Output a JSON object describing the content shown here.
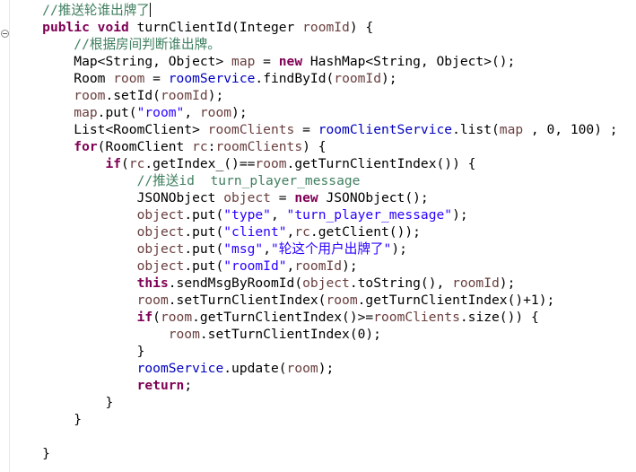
{
  "editor": {
    "lines": [
      {
        "indent": 4,
        "tokens": [
          {
            "c": "cm",
            "t": "//推送轮谁出牌了"
          }
        ],
        "caret": true
      },
      {
        "indent": 4,
        "tokens": [
          {
            "c": "kw",
            "t": "public"
          },
          {
            "c": "",
            "t": " "
          },
          {
            "c": "kw",
            "t": "void"
          },
          {
            "c": "",
            "t": " turnClientId(Integer "
          },
          {
            "c": "vr",
            "t": "roomId"
          },
          {
            "c": "",
            "t": ") {"
          }
        ]
      },
      {
        "indent": 8,
        "tokens": [
          {
            "c": "cm",
            "t": "//根据房间判断谁出牌。"
          }
        ]
      },
      {
        "indent": 8,
        "tokens": [
          {
            "c": "",
            "t": "Map<String, Object> "
          },
          {
            "c": "vr",
            "t": "map"
          },
          {
            "c": "",
            "t": " = "
          },
          {
            "c": "kw",
            "t": "new"
          },
          {
            "c": "",
            "t": " HashMap<String, Object>();"
          }
        ]
      },
      {
        "indent": 8,
        "tokens": [
          {
            "c": "",
            "t": "Room "
          },
          {
            "c": "vr",
            "t": "room"
          },
          {
            "c": "",
            "t": " = "
          },
          {
            "c": "fd",
            "t": "roomService"
          },
          {
            "c": "",
            "t": ".findById("
          },
          {
            "c": "vr",
            "t": "roomId"
          },
          {
            "c": "",
            "t": ");"
          }
        ]
      },
      {
        "indent": 8,
        "tokens": [
          {
            "c": "vr",
            "t": "room"
          },
          {
            "c": "",
            "t": ".setId("
          },
          {
            "c": "vr",
            "t": "roomId"
          },
          {
            "c": "",
            "t": ");"
          }
        ]
      },
      {
        "indent": 8,
        "tokens": [
          {
            "c": "vr",
            "t": "map"
          },
          {
            "c": "",
            "t": ".put("
          },
          {
            "c": "st",
            "t": "\"room\""
          },
          {
            "c": "",
            "t": ", "
          },
          {
            "c": "vr",
            "t": "room"
          },
          {
            "c": "",
            "t": ");"
          }
        ]
      },
      {
        "indent": 8,
        "tokens": [
          {
            "c": "",
            "t": "List<RoomClient> "
          },
          {
            "c": "vr",
            "t": "roomClients"
          },
          {
            "c": "",
            "t": " = "
          },
          {
            "c": "fd",
            "t": "roomClientService"
          },
          {
            "c": "",
            "t": ".list("
          },
          {
            "c": "vr",
            "t": "map"
          },
          {
            "c": "",
            "t": " , 0, 100) ;"
          }
        ]
      },
      {
        "indent": 8,
        "tokens": [
          {
            "c": "kw",
            "t": "for"
          },
          {
            "c": "",
            "t": "(RoomClient "
          },
          {
            "c": "vr",
            "t": "rc"
          },
          {
            "c": "",
            "t": ":"
          },
          {
            "c": "vr",
            "t": "roomClients"
          },
          {
            "c": "",
            "t": ") {"
          }
        ]
      },
      {
        "indent": 12,
        "tokens": [
          {
            "c": "kw",
            "t": "if"
          },
          {
            "c": "",
            "t": "("
          },
          {
            "c": "vr",
            "t": "rc"
          },
          {
            "c": "",
            "t": ".getIndex_()=="
          },
          {
            "c": "vr",
            "t": "room"
          },
          {
            "c": "",
            "t": ".getTurnClientIndex()) {"
          }
        ]
      },
      {
        "indent": 16,
        "tokens": [
          {
            "c": "cm",
            "t": "//推送id  turn_player_message"
          }
        ]
      },
      {
        "indent": 16,
        "tokens": [
          {
            "c": "",
            "t": "JSONObject "
          },
          {
            "c": "vr",
            "t": "object"
          },
          {
            "c": "",
            "t": " = "
          },
          {
            "c": "kw",
            "t": "new"
          },
          {
            "c": "",
            "t": " JSONObject();"
          }
        ]
      },
      {
        "indent": 16,
        "tokens": [
          {
            "c": "vr",
            "t": "object"
          },
          {
            "c": "",
            "t": ".put("
          },
          {
            "c": "st",
            "t": "\"type\""
          },
          {
            "c": "",
            "t": ", "
          },
          {
            "c": "st",
            "t": "\"turn_player_message\""
          },
          {
            "c": "",
            "t": ");"
          }
        ]
      },
      {
        "indent": 16,
        "tokens": [
          {
            "c": "vr",
            "t": "object"
          },
          {
            "c": "",
            "t": ".put("
          },
          {
            "c": "st",
            "t": "\"client\""
          },
          {
            "c": "",
            "t": ","
          },
          {
            "c": "vr",
            "t": "rc"
          },
          {
            "c": "",
            "t": ".getClient());"
          }
        ]
      },
      {
        "indent": 16,
        "tokens": [
          {
            "c": "vr",
            "t": "object"
          },
          {
            "c": "",
            "t": ".put("
          },
          {
            "c": "st",
            "t": "\"msg\""
          },
          {
            "c": "",
            "t": ","
          },
          {
            "c": "st",
            "t": "\"轮这个用户出牌了\""
          },
          {
            "c": "",
            "t": ");"
          }
        ]
      },
      {
        "indent": 16,
        "tokens": [
          {
            "c": "vr",
            "t": "object"
          },
          {
            "c": "",
            "t": ".put("
          },
          {
            "c": "st",
            "t": "\"roomId\""
          },
          {
            "c": "",
            "t": ","
          },
          {
            "c": "vr",
            "t": "roomId"
          },
          {
            "c": "",
            "t": ");"
          }
        ]
      },
      {
        "indent": 16,
        "tokens": [
          {
            "c": "kw",
            "t": "this"
          },
          {
            "c": "",
            "t": ".sendMsgByRoomId("
          },
          {
            "c": "vr",
            "t": "object"
          },
          {
            "c": "",
            "t": ".toString(), "
          },
          {
            "c": "vr",
            "t": "roomId"
          },
          {
            "c": "",
            "t": ");"
          }
        ]
      },
      {
        "indent": 16,
        "tokens": [
          {
            "c": "vr",
            "t": "room"
          },
          {
            "c": "",
            "t": ".setTurnClientIndex("
          },
          {
            "c": "vr",
            "t": "room"
          },
          {
            "c": "",
            "t": ".getTurnClientIndex()+1);"
          }
        ]
      },
      {
        "indent": 16,
        "tokens": [
          {
            "c": "kw",
            "t": "if"
          },
          {
            "c": "",
            "t": "("
          },
          {
            "c": "vr",
            "t": "room"
          },
          {
            "c": "",
            "t": ".getTurnClientIndex()>="
          },
          {
            "c": "vr",
            "t": "roomClients"
          },
          {
            "c": "",
            "t": ".size()) {"
          }
        ]
      },
      {
        "indent": 20,
        "tokens": [
          {
            "c": "vr",
            "t": "room"
          },
          {
            "c": "",
            "t": ".setTurnClientIndex(0);"
          }
        ]
      },
      {
        "indent": 16,
        "tokens": [
          {
            "c": "",
            "t": "}"
          }
        ]
      },
      {
        "indent": 16,
        "tokens": [
          {
            "c": "fd",
            "t": "roomService"
          },
          {
            "c": "",
            "t": ".update("
          },
          {
            "c": "vr",
            "t": "room"
          },
          {
            "c": "",
            "t": ");"
          }
        ]
      },
      {
        "indent": 16,
        "tokens": [
          {
            "c": "kw",
            "t": "return"
          },
          {
            "c": "",
            "t": ";"
          }
        ]
      },
      {
        "indent": 12,
        "tokens": [
          {
            "c": "",
            "t": "}"
          }
        ]
      },
      {
        "indent": 8,
        "tokens": [
          {
            "c": "",
            "t": "}"
          }
        ]
      },
      {
        "indent": 0,
        "tokens": []
      },
      {
        "indent": 4,
        "tokens": [
          {
            "c": "",
            "t": "}"
          }
        ]
      }
    ]
  }
}
